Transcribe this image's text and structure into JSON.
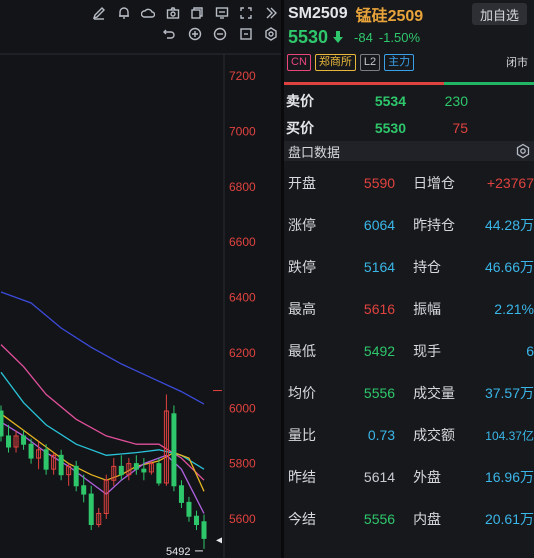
{
  "symbol": {
    "code": "SM2509",
    "name": "锰硅2509",
    "add_favorite_label": "加自选",
    "last_price": "5530",
    "change": "-84",
    "change_pct": "-1.50%"
  },
  "tags": {
    "region": "CN",
    "exchange": "郑商所",
    "level": "L2",
    "main_contract": "主力",
    "market_status": "闭市"
  },
  "order_book": {
    "ask_label": "卖价",
    "ask_price": "5534",
    "ask_volume": "230",
    "bid_label": "买价",
    "bid_price": "5530",
    "bid_volume": "75"
  },
  "panel": {
    "title": "盘口数据",
    "rows": [
      {
        "l1": "开盘",
        "v1": "5590",
        "l2": "日增仓",
        "v2": "+23767"
      },
      {
        "l1": "涨停",
        "v1": "6064",
        "l2": "昨持仓",
        "v2": "44.28万"
      },
      {
        "l1": "跌停",
        "v1": "5164",
        "l2": "持仓",
        "v2": "46.66万"
      },
      {
        "l1": "最高",
        "v1": "5616",
        "l2": "振幅",
        "v2": "2.21%"
      },
      {
        "l1": "最低",
        "v1": "5492",
        "l2": "现手",
        "v2": "6"
      },
      {
        "l1": "均价",
        "v1": "5556",
        "l2": "成交量",
        "v2": "37.57万"
      },
      {
        "l1": "量比",
        "v1": "0.73",
        "l2": "成交额",
        "v2": "104.37亿"
      },
      {
        "l1": "昨结",
        "v1": "5614",
        "l2": "外盘",
        "v2": "16.96万"
      },
      {
        "l1": "今结",
        "v1": "5556",
        "l2": "内盘",
        "v2": "20.61万"
      }
    ]
  },
  "toolbar_icons": [
    "pencil-icon",
    "bell-icon",
    "cloud-icon",
    "camera-icon",
    "copy-icon",
    "screen-icon",
    "fullscreen-icon",
    "collapse-icon"
  ],
  "toolbar_sub_icons": [
    "undo-icon",
    "zoom-in-icon",
    "zoom-out-icon",
    "reset-icon",
    "settings-icon"
  ],
  "colors": {
    "up": "#e0433f",
    "down": "#2ec76b",
    "ma_blue": "#3b4bd8",
    "ma_pink": "#e0509b",
    "ma_cyan": "#29c4d9",
    "ma_yellow": "#e6b422",
    "ma_purple": "#b062e0"
  },
  "chart_data": {
    "type": "candlestick",
    "y_ticks": [
      7200,
      7000,
      6800,
      6600,
      6400,
      6200,
      6000,
      5800,
      5600
    ],
    "ylim": [
      5510,
      7275
    ],
    "low_annotation": "5492",
    "candles": [
      {
        "o": 5990,
        "h": 6010,
        "l": 5880,
        "c": 5900
      },
      {
        "o": 5900,
        "h": 5940,
        "l": 5840,
        "c": 5860
      },
      {
        "o": 5860,
        "h": 5920,
        "l": 5840,
        "c": 5900
      },
      {
        "o": 5900,
        "h": 5920,
        "l": 5850,
        "c": 5870
      },
      {
        "o": 5870,
        "h": 5890,
        "l": 5800,
        "c": 5820
      },
      {
        "o": 5820,
        "h": 5880,
        "l": 5780,
        "c": 5850
      },
      {
        "o": 5850,
        "h": 5870,
        "l": 5760,
        "c": 5780
      },
      {
        "o": 5780,
        "h": 5840,
        "l": 5760,
        "c": 5830
      },
      {
        "o": 5830,
        "h": 5850,
        "l": 5740,
        "c": 5760
      },
      {
        "o": 5760,
        "h": 5800,
        "l": 5720,
        "c": 5790
      },
      {
        "o": 5790,
        "h": 5810,
        "l": 5700,
        "c": 5720
      },
      {
        "o": 5720,
        "h": 5760,
        "l": 5660,
        "c": 5690
      },
      {
        "o": 5690,
        "h": 5720,
        "l": 5560,
        "c": 5580
      },
      {
        "o": 5580,
        "h": 5640,
        "l": 5570,
        "c": 5620
      },
      {
        "o": 5620,
        "h": 5760,
        "l": 5600,
        "c": 5740
      },
      {
        "o": 5740,
        "h": 5820,
        "l": 5720,
        "c": 5790
      },
      {
        "o": 5790,
        "h": 5830,
        "l": 5740,
        "c": 5760
      },
      {
        "o": 5760,
        "h": 5820,
        "l": 5740,
        "c": 5800
      },
      {
        "o": 5800,
        "h": 5830,
        "l": 5760,
        "c": 5780
      },
      {
        "o": 5780,
        "h": 5820,
        "l": 5740,
        "c": 5770
      },
      {
        "o": 5770,
        "h": 5810,
        "l": 5760,
        "c": 5800
      },
      {
        "o": 5800,
        "h": 5820,
        "l": 5720,
        "c": 5730
      },
      {
        "o": 5730,
        "h": 6050,
        "l": 5720,
        "c": 5990
      },
      {
        "o": 5980,
        "h": 6010,
        "l": 5700,
        "c": 5720
      },
      {
        "o": 5720,
        "h": 5740,
        "l": 5640,
        "c": 5660
      },
      {
        "o": 5660,
        "h": 5680,
        "l": 5590,
        "c": 5610
      },
      {
        "o": 5610,
        "h": 5630,
        "l": 5560,
        "c": 5580
      },
      {
        "o": 5590,
        "h": 5616,
        "l": 5492,
        "c": 5530
      }
    ],
    "ma_lines": [
      {
        "color": "#3b4bd8",
        "points": [
          [
            0,
            6420
          ],
          [
            4,
            6380
          ],
          [
            8,
            6290
          ],
          [
            12,
            6220
          ],
          [
            16,
            6160
          ],
          [
            20,
            6110
          ],
          [
            24,
            6060
          ],
          [
            27,
            6015
          ]
        ]
      },
      {
        "color": "#e0509b",
        "points": [
          [
            0,
            6230
          ],
          [
            3,
            6150
          ],
          [
            6,
            6050
          ],
          [
            10,
            5960
          ],
          [
            14,
            5900
          ],
          [
            18,
            5870
          ],
          [
            21,
            5870
          ],
          [
            24,
            5820
          ],
          [
            27,
            5740
          ]
        ]
      },
      {
        "color": "#29c4d9",
        "points": [
          [
            0,
            6130
          ],
          [
            3,
            6020
          ],
          [
            6,
            5940
          ],
          [
            10,
            5870
          ],
          [
            14,
            5830
          ],
          [
            18,
            5840
          ],
          [
            21,
            5850
          ],
          [
            24,
            5830
          ],
          [
            27,
            5780
          ]
        ]
      },
      {
        "color": "#e6b422",
        "points": [
          [
            0,
            5980
          ],
          [
            3,
            5920
          ],
          [
            6,
            5860
          ],
          [
            9,
            5800
          ],
          [
            12,
            5760
          ],
          [
            14,
            5740
          ],
          [
            16,
            5760
          ],
          [
            18,
            5790
          ],
          [
            21,
            5810
          ],
          [
            23,
            5840
          ],
          [
            25,
            5820
          ],
          [
            27,
            5700
          ]
        ]
      },
      {
        "color": "#b062e0",
        "points": [
          [
            0,
            5950
          ],
          [
            3,
            5900
          ],
          [
            6,
            5840
          ],
          [
            9,
            5790
          ],
          [
            12,
            5730
          ],
          [
            14,
            5690
          ],
          [
            16,
            5740
          ],
          [
            19,
            5800
          ],
          [
            22,
            5830
          ],
          [
            24,
            5780
          ],
          [
            27,
            5620
          ]
        ]
      }
    ]
  }
}
